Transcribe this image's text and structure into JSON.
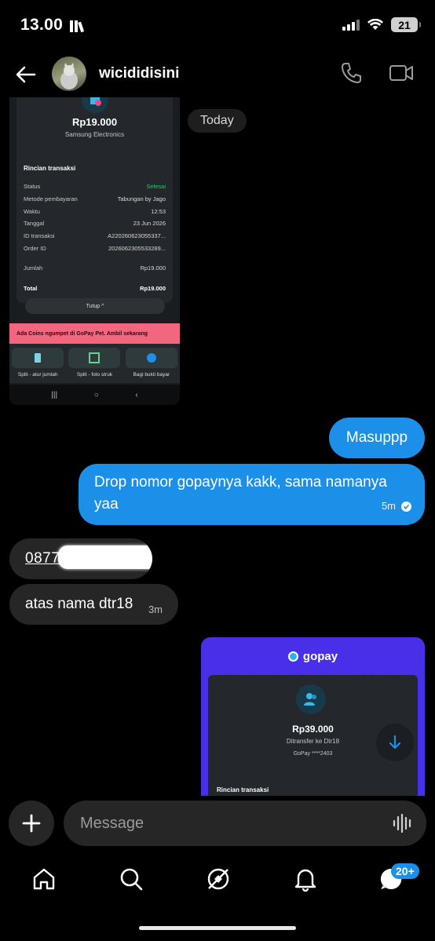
{
  "status_bar": {
    "time": "13.00",
    "battery": "21"
  },
  "header": {
    "contact_name": "wicididisini"
  },
  "chat": {
    "date_label": "Today",
    "receipt1": {
      "amount": "Rp19.000",
      "merchant": "Samsung Electronics",
      "section_title": "Rincian transaksi",
      "rows": [
        {
          "label": "Status",
          "value": "Selesai"
        },
        {
          "label": "Metode pembayaran",
          "value": "Tabungan by Jago"
        },
        {
          "label": "Waktu",
          "value": "12:53"
        },
        {
          "label": "Tanggal",
          "value": "23 Jun 2026"
        },
        {
          "label": "ID transaksi",
          "value": "A220260623055337..."
        },
        {
          "label": "Order ID",
          "value": "2026062305533289..."
        },
        {
          "label": "Jumlah",
          "value": "Rp19.000"
        },
        {
          "label": "Total",
          "value": "Rp19.000"
        }
      ],
      "close_label": "Tutup",
      "promo": "Ada Coins ngumpet di GoPay Pet. Ambil sekarang",
      "actions": [
        "Split - atur jumlah",
        "Split - foto struk",
        "Bagi bukti bayar"
      ]
    },
    "messages": {
      "masuppp": "Masuppp",
      "drop": "Drop nomor gopaynya kakk, sama namanya yaa",
      "drop_time": "5m",
      "number": "0877 0802403",
      "atas": "atas nama dtr18",
      "atas_time": "3m"
    },
    "receipt2": {
      "brand": "gopay",
      "amount": "Rp39.000",
      "desc": "Ditransfer ke Dtr18",
      "account": "GoPay ****2403",
      "section_title": "Rincian transaksi"
    }
  },
  "composer": {
    "placeholder": "Message"
  },
  "bottom_nav": {
    "badge": "20+"
  },
  "colors": {
    "accent": "#1c8fe8",
    "bubble_in": "#262626",
    "gopay": "#4a2fe8"
  }
}
